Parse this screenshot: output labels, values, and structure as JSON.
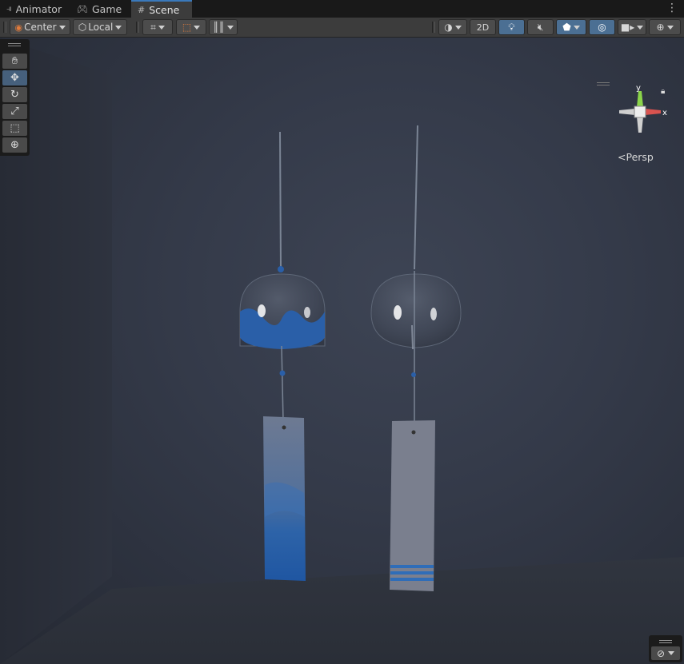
{
  "tabs": [
    {
      "label": "Animator",
      "icon": "animator-icon"
    },
    {
      "label": "Game",
      "icon": "gamepad-icon"
    },
    {
      "label": "Scene",
      "icon": "hash-icon"
    }
  ],
  "toolbar": {
    "pivot_label": "Center",
    "space_label": "Local",
    "mode_2d_label": "2D"
  },
  "gizmo": {
    "y_label": "y",
    "x_label": "x",
    "projection_label": "Persp"
  },
  "colors": {
    "accent_blue": "#3a79bb",
    "x_axis": "#d9534f",
    "y_axis": "#8bd44a",
    "bell_blue": "#2a5fa8"
  }
}
